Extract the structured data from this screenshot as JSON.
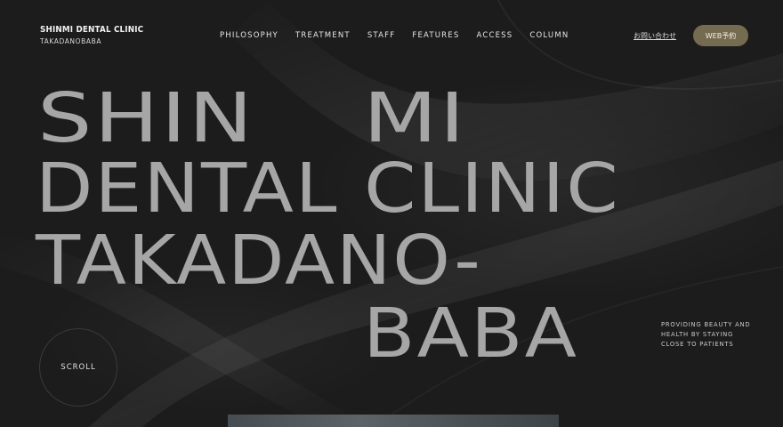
{
  "header": {
    "logo_title": "SHINMI DENTAL CLINIC",
    "logo_sub": "TAKADANOBABA",
    "nav": [
      "PHILOSOPHY",
      "TREATMENT",
      "STAFF",
      "FEATURES",
      "ACCESS",
      "COLUMN"
    ],
    "contact_label": "お問い合わせ",
    "web_reserve_label": "WEB予約"
  },
  "hero": {
    "line1a": "SHIN",
    "line1b": "MI",
    "line2": "DENTAL CLINIC",
    "line3": "TAKADANO-",
    "line4": "BABA",
    "tagline": [
      "PROVIDING BEAUTY AND",
      "HEALTH BY STAYING",
      "CLOSE TO PATIENTS"
    ],
    "scroll_label": "SCROLL"
  },
  "colors": {
    "background": "#1d1d1d",
    "hero_text": "#a6a6a6",
    "accent_button": "#756b50"
  }
}
